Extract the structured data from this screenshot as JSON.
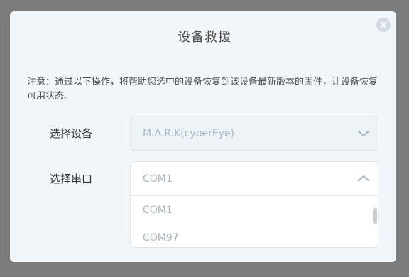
{
  "dialog": {
    "title": "设备救援",
    "notice": "注意：通过以下操作，将帮助您选中的设备恢复到该设备最新版本的固件，让设备恢复可用状态。",
    "device": {
      "label": "选择设备",
      "value": "M.A.R.K(cyberEye)"
    },
    "port": {
      "label": "选择串口",
      "value": "COM1",
      "options": [
        "COM1",
        "COM97"
      ]
    }
  },
  "icons": {
    "close": "close-icon",
    "device_chevron": "chevron-down-icon",
    "port_chevron": "chevron-up-icon"
  }
}
